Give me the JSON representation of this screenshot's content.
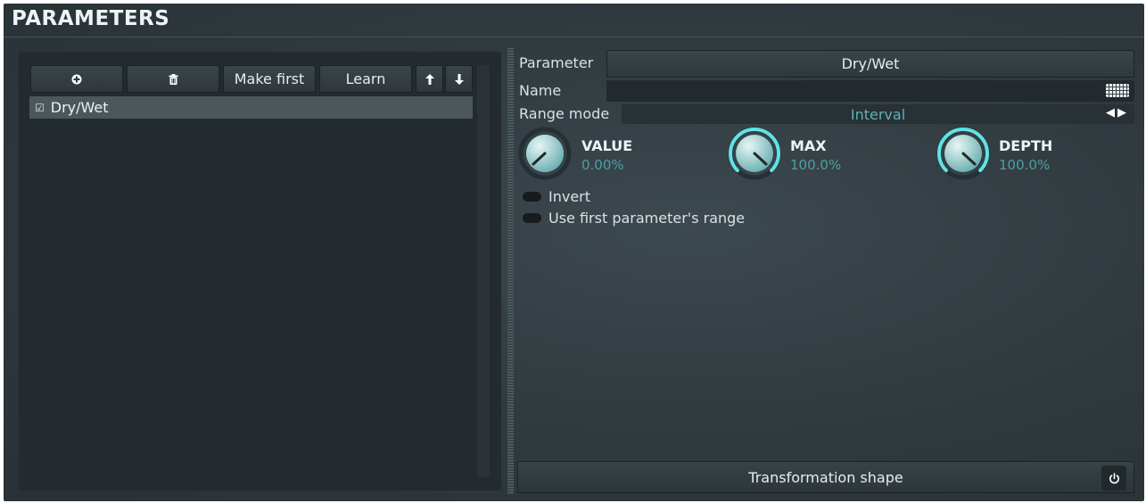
{
  "header": {
    "title": "PARAMETERS"
  },
  "toolbar": {
    "add_icon": "plus-circle-icon",
    "delete_icon": "trash-icon",
    "make_first_label": "Make first",
    "learn_label": "Learn",
    "up_icon": "arrow-up-icon",
    "down_icon": "arrow-down-icon"
  },
  "list": {
    "items": [
      {
        "label": "Dry/Wet",
        "checked": true,
        "selected": true
      }
    ]
  },
  "details": {
    "parameter_label": "Parameter",
    "parameter_value": "Dry/Wet",
    "name_label": "Name",
    "name_value": "",
    "range_mode_label": "Range mode",
    "range_mode_value": "Interval",
    "knobs": [
      {
        "title": "VALUE",
        "value": "0.00%",
        "fraction": 0.0
      },
      {
        "title": "MAX",
        "value": "100.0%",
        "fraction": 1.0
      },
      {
        "title": "DEPTH",
        "value": "100.0%",
        "fraction": 1.0
      }
    ],
    "invert_label": "Invert",
    "invert_on": false,
    "use_first_range_label": "Use first parameter's range",
    "use_first_range_on": false,
    "transformation_label": "Transformation shape"
  },
  "colors": {
    "accent": "#5fe3e6",
    "value_text": "#4f9ea2",
    "panel_bg": "#323d42"
  }
}
